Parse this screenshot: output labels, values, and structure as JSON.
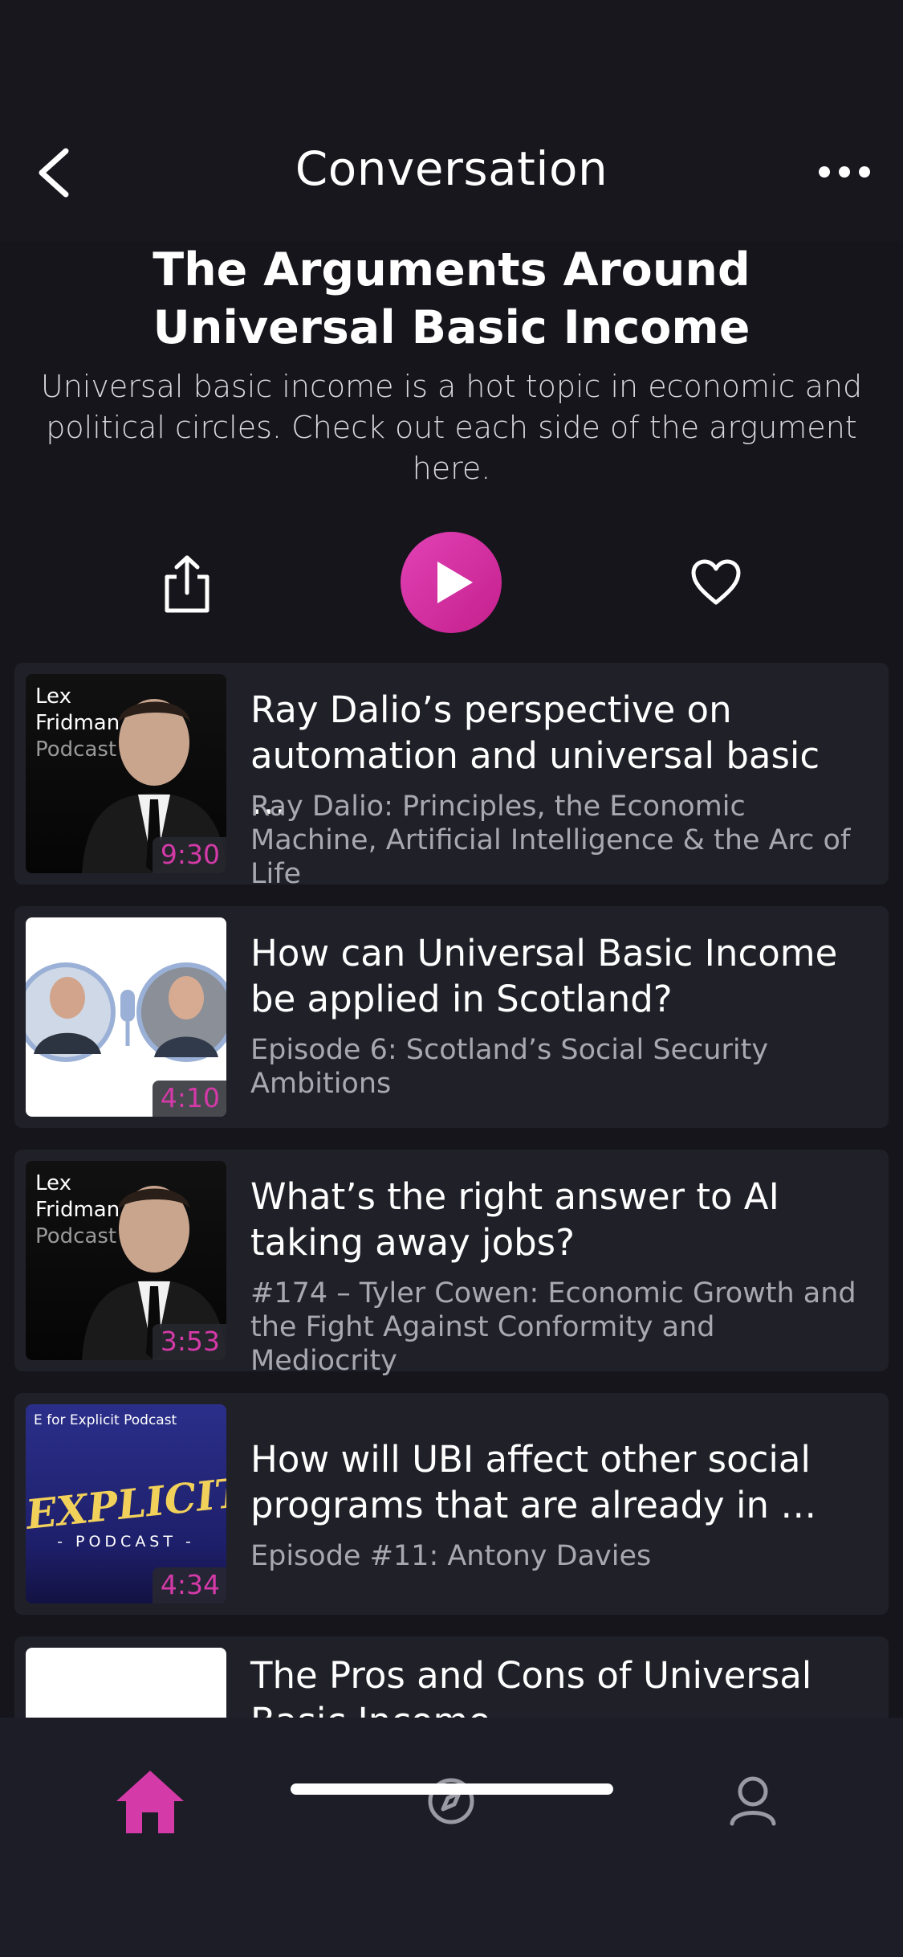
{
  "header": {
    "title": "Conversation"
  },
  "conversation": {
    "title": "The Arguments Around Universal Basic Income",
    "description": "Universal basic income is a hot topic in economic and political circles. Check out each side of the argument here."
  },
  "episodes": [
    {
      "title": "Ray Dalio’s perspective on automation and universal basic …",
      "subtitle": "Ray Dalio: Principles, the Economic Machine, Artificial Intelligence & the Arc of Life",
      "duration": "9:30",
      "thumb": {
        "line1": "Lex",
        "line2": "Fridman",
        "line3": "Podcast"
      }
    },
    {
      "title": "How can Universal Basic Income be applied in Scotland?",
      "subtitle": "Episode 6: Scotland’s Social Security Ambitions",
      "duration": "4:10"
    },
    {
      "title": "What’s the right answer to AI taking away jobs?",
      "subtitle": "#174 – Tyler Cowen: Economic Growth and the Fight Against Conformity and Mediocrity",
      "duration": "3:53",
      "thumb": {
        "line1": "Lex",
        "line2": "Fridman",
        "line3": "Podcast"
      }
    },
    {
      "title": "How will UBI affect other social programs that are already in …",
      "subtitle": "Episode #11: Antony Davies",
      "duration": "4:34",
      "thumb": {
        "top": "E for Explicit Podcast",
        "big": "EXPLICIT",
        "small": "- PODCAST -"
      }
    },
    {
      "title": "The Pros and Cons of Universal Basic Income"
    }
  ],
  "tabs": {
    "active": "home"
  },
  "colors": {
    "accent": "#d43aa8",
    "background": "#15151b",
    "card": "#202028"
  }
}
